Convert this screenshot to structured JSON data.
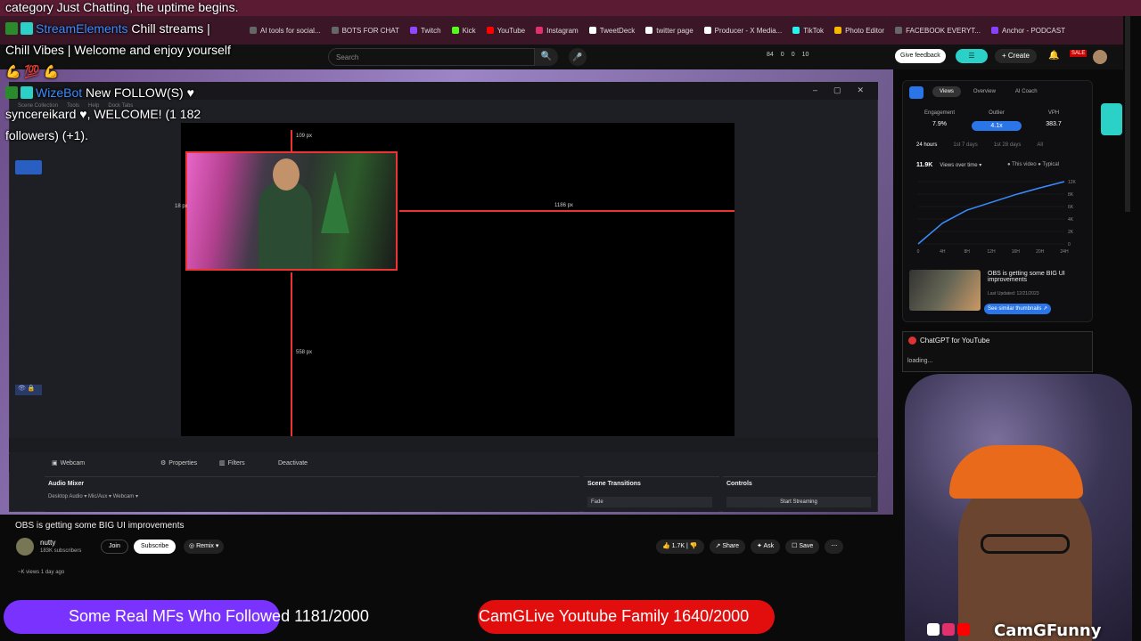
{
  "bookmarks": [
    {
      "label": "AI tools for social...",
      "color": "#666"
    },
    {
      "label": "BOTS FOR CHAT",
      "color": "#666"
    },
    {
      "label": "Twitch",
      "color": "#9146ff"
    },
    {
      "label": "Kick",
      "color": "#53fc18"
    },
    {
      "label": "YouTube",
      "color": "#ff0000"
    },
    {
      "label": "Instagram",
      "color": "#e1306c"
    },
    {
      "label": "TweetDeck",
      "color": "#ffffff"
    },
    {
      "label": "twitter page",
      "color": "#ffffff"
    },
    {
      "label": "Producer - X Media...",
      "color": "#ffffff"
    },
    {
      "label": "TikTok",
      "color": "#25f4ee"
    },
    {
      "label": "Photo Editor",
      "color": "#f5b700"
    },
    {
      "label": "FACEBOOK EVERYT...",
      "color": "#666"
    },
    {
      "label": "Anchor - PODCAST",
      "color": "#8940fa"
    }
  ],
  "youtube_header": {
    "search_placeholder": "Search",
    "search_icon": "search-icon",
    "stats": [
      "84",
      "0",
      "0",
      "10"
    ],
    "feedback_label": "Give feedback",
    "create_label": "+ Create",
    "sale_label": "SALE"
  },
  "obs": {
    "window_controls": [
      "–",
      "▢",
      "✕"
    ],
    "menu": [
      "Scene Collection",
      "Tools",
      "Help",
      "Dock Tabs"
    ],
    "guides": {
      "top": "109 px",
      "left": "18 px",
      "right": "1186 px",
      "bottom": "558 px"
    },
    "source_name": "Webcam",
    "properties_label": "Properties",
    "filters_label": "Filters",
    "deactivate_label": "Deactivate",
    "audio_mixer_title": "Audio Mixer",
    "audio_channels": "Desktop Audio ▾  Mic/Aux ▾  Webcam ▾",
    "scene_transitions_title": "Scene Transitions",
    "transition_value": "Fade",
    "controls_title": "Controls",
    "start_streaming_label": "Start Streaming"
  },
  "video": {
    "title": "OBS is getting some BIG UI improvements",
    "channel_name": "nutty",
    "channel_subs": "183K subscribers",
    "join_label": "Join",
    "subscribe_label": "Subscribe",
    "remix_label": "Remix",
    "likes": "1.7K",
    "share_label": "Share",
    "ask_label": "Ask",
    "save_label": "Save",
    "views": "~K views  1 day ago"
  },
  "vidiq": {
    "tabs": [
      "Views",
      "Overview",
      "AI Coach"
    ],
    "metrics": [
      {
        "label": "Engagement",
        "value": "7.9%"
      },
      {
        "label": "Outlier",
        "value": "4.1x"
      },
      {
        "label": "VPH",
        "value": "383.7"
      }
    ],
    "time_tabs": [
      "24 hours",
      "1st 7 days",
      "1st 28 days",
      "All"
    ],
    "views_count": "11.9K",
    "views_metric": "Views over time ▾",
    "legend": "● This video  ● Typical",
    "thumb_title": "OBS is getting some BIG UI improvements",
    "thumb_date": "Last Updated: 12/21/2023",
    "similar_label": "See similar thumbnails ↗"
  },
  "chart_data": {
    "type": "line",
    "x": [
      "0",
      "4H",
      "8H",
      "12H",
      "16H",
      "20H",
      "24H"
    ],
    "series": [
      {
        "values": [
          0,
          4,
          6.5,
          8,
          9.5,
          10.8,
          12
        ]
      }
    ],
    "yticks": [
      "12K",
      "8K",
      "6K",
      "4K",
      "2K",
      "0"
    ],
    "ylim": [
      0,
      12
    ]
  },
  "chatgpt": {
    "title": "ChatGPT for YouTube",
    "status": "loading..."
  },
  "chat": {
    "lines": [
      {
        "text": "category Just Chatting, the uptime begins."
      },
      {
        "user": "StreamElements",
        "text": " Chill streams |"
      },
      {
        "text": "Chill Vibes | Welcome and enjoy yourself"
      },
      {
        "text": "💪 💯 💪"
      },
      {
        "user": "WizeBot",
        "text": " New FOLLOW(S) ♥"
      },
      {
        "text": "syncereikard ♥, WELCOME! (1 182"
      },
      {
        "text": "followers) (+1)."
      }
    ]
  },
  "goals": {
    "left": "Some Real MFs Who Followed 1181/2000",
    "right": "CamGLive Youtube Family 1640/2000"
  },
  "cam": {
    "name": "CamGFunny"
  }
}
